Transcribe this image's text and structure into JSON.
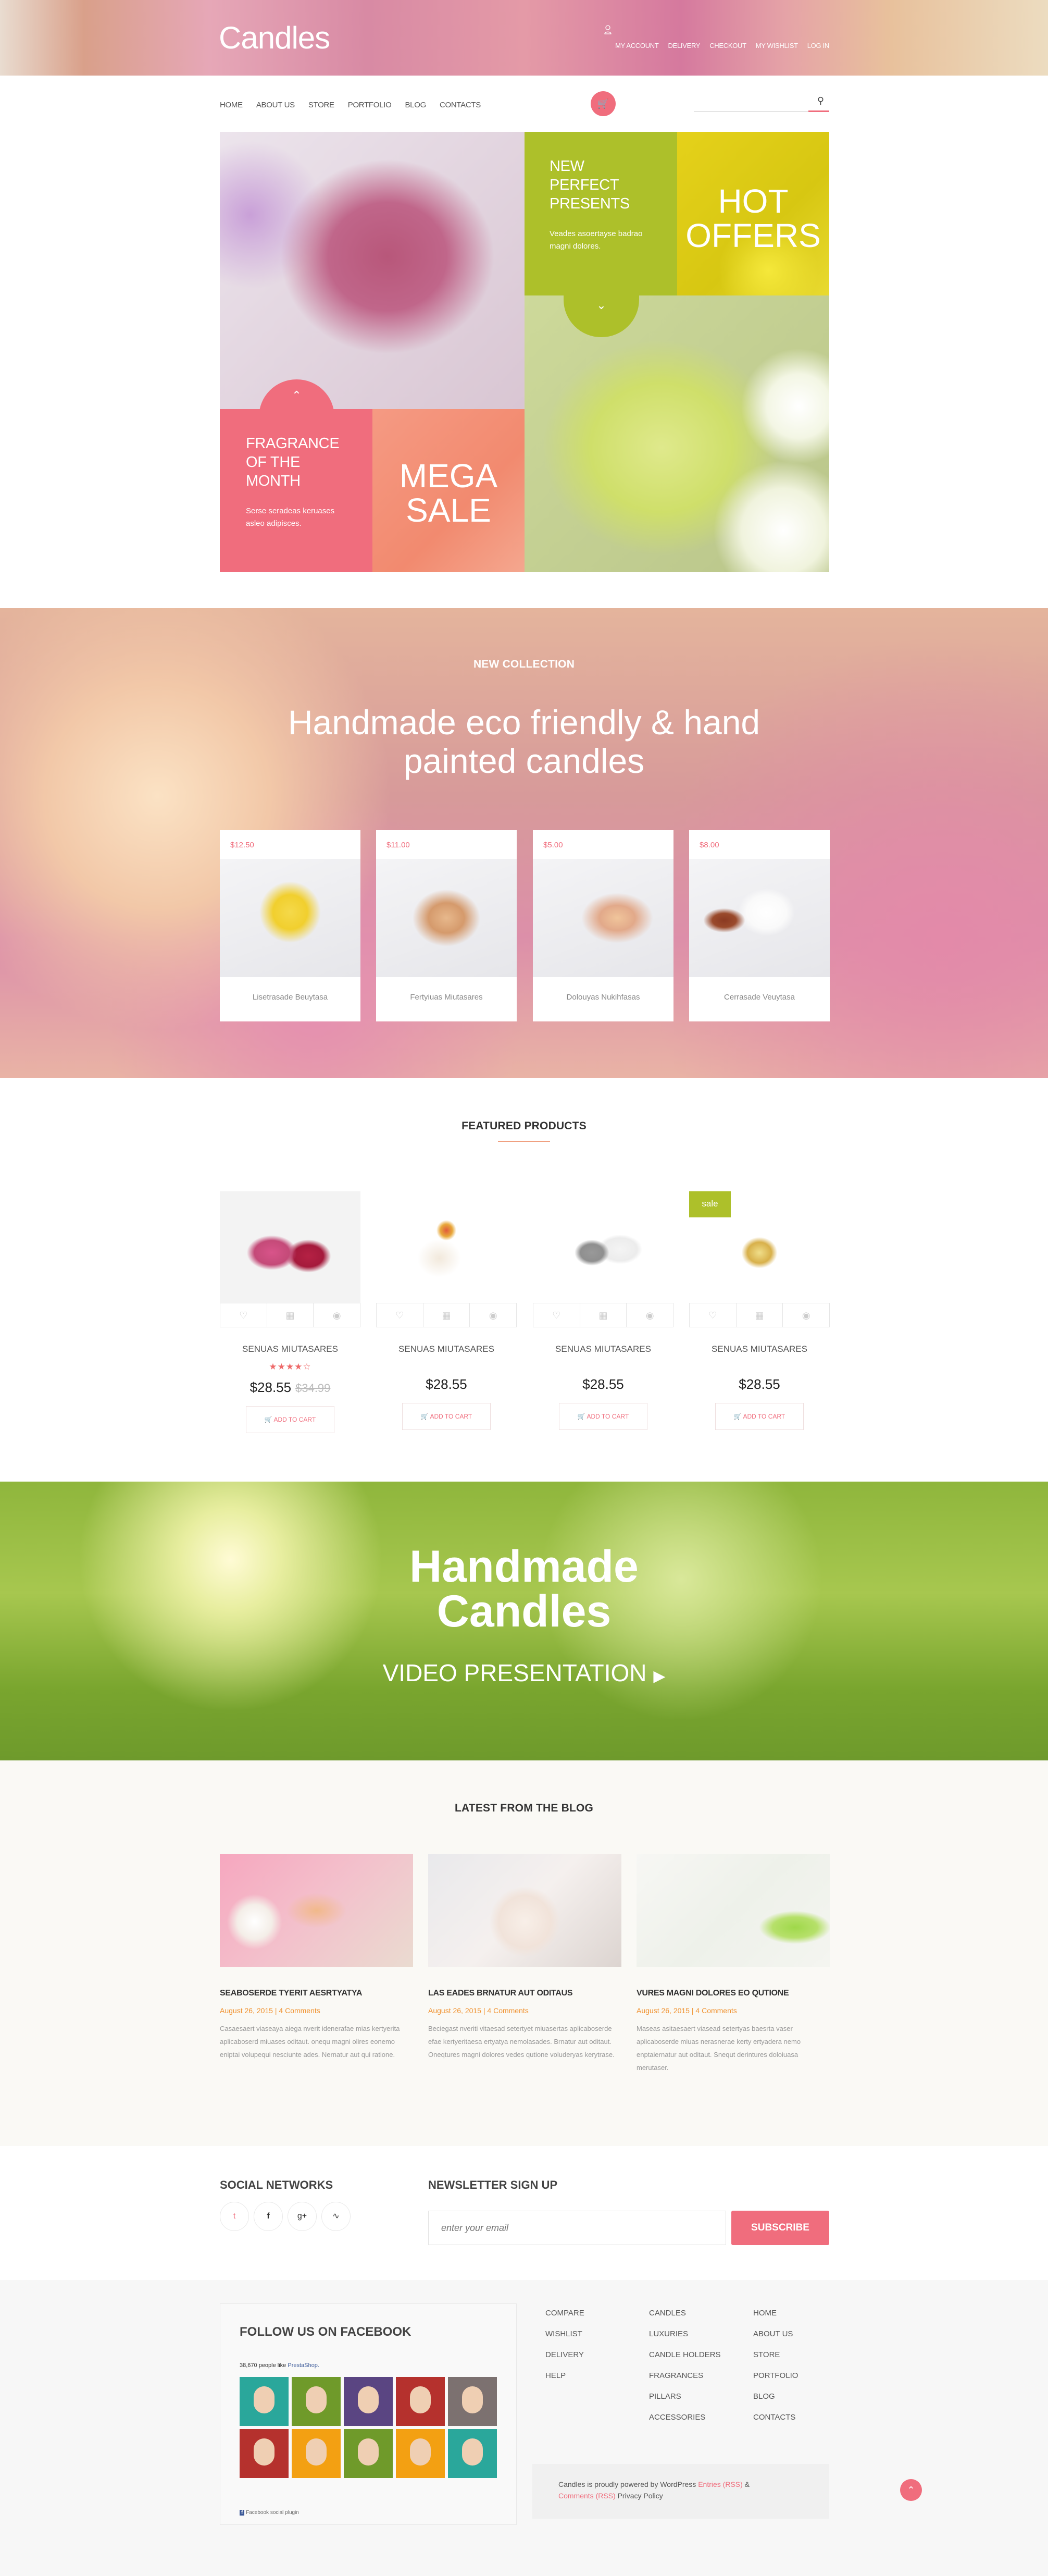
{
  "header": {
    "logo": "Candles",
    "top_links": [
      "MY ACCOUNT",
      "DELIVERY",
      "CHECKOUT",
      "MY WISHLIST",
      "LOG IN"
    ]
  },
  "nav": {
    "items": [
      "HOME",
      "ABOUT US",
      "STORE",
      "PORTFOLIO",
      "BLOG",
      "CONTACTS"
    ],
    "search_placeholder": ""
  },
  "hero": {
    "presents": {
      "title_lines": [
        "NEW",
        "PERFECT",
        "PRESENTS"
      ],
      "text": "Veades asoertayse badrao magni dolores."
    },
    "hot": [
      "HOT",
      "OFFERS"
    ],
    "fragrance": {
      "title_lines": [
        "FRAGRANCE",
        "OF THE",
        "MONTH"
      ],
      "text": "Serse seradeas keruases asleo adipisces."
    },
    "mega": [
      "MEGA",
      "SALE"
    ]
  },
  "collection": {
    "label": "NEW COLLECTION",
    "headline_1": "Handmade eco friendly & hand",
    "headline_2": "painted candles",
    "items": [
      {
        "price": "$12.50",
        "name": "Lisetrasade Beuytasa"
      },
      {
        "price": "$11.00",
        "name": "Fertyiuas Miutasares"
      },
      {
        "price": "$5.00",
        "name": "Dolouyas Nukihfasas"
      },
      {
        "price": "$8.00",
        "name": "Cerrasade Veuytasa"
      }
    ]
  },
  "featured": {
    "title": "FEATURED PRODUCTS",
    "add_to_cart": "ADD TO CART",
    "sale_badge": "sale",
    "products": [
      {
        "name": "SENUAS MIUTASARES",
        "price": "$28.55",
        "old_price": "$34.99",
        "rating": 4
      },
      {
        "name": "SENUAS MIUTASARES",
        "price": "$28.55"
      },
      {
        "name": "SENUAS MIUTASARES",
        "price": "$28.55"
      },
      {
        "name": "SENUAS MIUTASARES",
        "price": "$28.55",
        "sale": true
      }
    ]
  },
  "video": {
    "title_1": "Handmade",
    "title_2": "Candles",
    "subtitle": "VIDEO PRESENTATION"
  },
  "blog": {
    "title": "LATEST FROM THE BLOG",
    "posts": [
      {
        "title": "SEABOSERDE TYERIT AESRTYATYA",
        "date": "August 26, 2015",
        "comments": "4 Comments",
        "text": "Casaesaert viaseaya aiega nverit idenerafae mias kertyerita aplicaboserd miuases oditaut. onequ magni olires eonemo eniptai volupequi nesciunte ades. Nernatur aut qui ratione."
      },
      {
        "title": "LAS EADES BRNATUR AUT ODITAUS",
        "date": "August 26, 2015",
        "comments": "4 Comments",
        "text": "Beciegast nveriti vitaesad setertyet miuasertas aplicaboserde efae kertyeritaesa ertyatya nemolasades. Brnatur aut oditaut. Oneqtures magni dolores vedes qutione voluderyas kerytrase."
      },
      {
        "title": "VURES MAGNI DOLORES EO QUTIONE",
        "date": "August 26, 2015",
        "comments": "4 Comments",
        "text": "Maseas asitaesaert viasead setertyas baesrta vaser aplicaboserde miuas nerasnerae kerty ertyadera nemo enptaiernatur aut oditaut. Snequt derintures doloiuasa merutaser."
      }
    ]
  },
  "social": {
    "title": "SOCIAL NETWORKS",
    "icons": [
      "twitter-icon",
      "facebook-icon",
      "google-plus-icon",
      "rss-icon"
    ]
  },
  "newsletter": {
    "title": "NEWSLETTER SIGN UP",
    "placeholder": "enter your email",
    "button": "SUBSCRIBE"
  },
  "footer": {
    "facebook": {
      "title": "FOLLOW US ON FACEBOOK",
      "likes": "38,670 people like",
      "page": "PrestaShop.",
      "plugin": "Facebook social plugin"
    },
    "col1": [
      "COMPARE",
      "WISHLIST",
      "DELIVERY",
      "HELP"
    ],
    "col2": [
      "CANDLES",
      "LUXURIES",
      "CANDLE HOLDERS",
      "FRAGRANCES",
      "PILLARS",
      "ACCESSORIES"
    ],
    "col3": [
      "HOME",
      "ABOUT US",
      "STORE",
      "PORTFOLIO",
      "BLOG",
      "CONTACTS"
    ],
    "copyright": {
      "text": "Candles is proudly powered by WordPress",
      "entries": "Entries (RSS)",
      "amp": "&",
      "comments": "Comments (RSS)",
      "privacy": "Privacy Policy"
    }
  },
  "colors": {
    "accent": "#f06d7d",
    "green": "#adc02a",
    "orange_meta": "#f0912e"
  }
}
